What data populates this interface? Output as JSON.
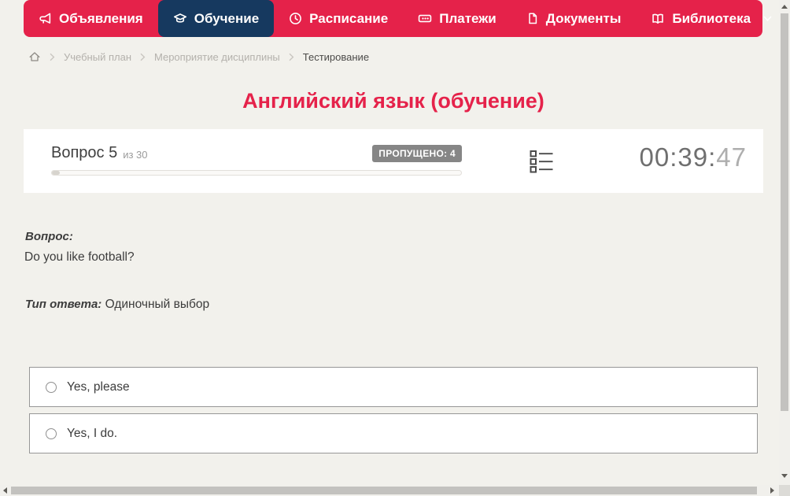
{
  "colors": {
    "navbar_bg": "#e5224a",
    "navbar_active_bg": "#16395f",
    "title_color": "#e5224a",
    "badge_bg": "#868686",
    "page_bg": "#f2f1ec"
  },
  "navbar": {
    "items": [
      {
        "label": "Объявления",
        "icon": "megaphone-icon",
        "active": false
      },
      {
        "label": "Обучение",
        "icon": "graduation-cap-icon",
        "active": true
      },
      {
        "label": "Расписание",
        "icon": "clock-icon",
        "active": false
      },
      {
        "label": "Платежи",
        "icon": "banknote-icon",
        "active": false
      },
      {
        "label": "Документы",
        "icon": "document-icon",
        "active": false
      },
      {
        "label": "Библиотека",
        "icon": "open-book-icon",
        "active": false,
        "has_dropdown": true
      }
    ]
  },
  "breadcrumb": {
    "items": [
      "Учебный план",
      "Мероприятие дисциплины",
      "Тестирование"
    ]
  },
  "page_title": "Английский язык (обучение)",
  "quiz_header": {
    "question_label": "Вопрос 5",
    "question_total": "из 30",
    "skipped_badge": "ПРОПУЩЕНО: 4",
    "progress_percent": 2,
    "timer": {
      "main": "00:39:",
      "seconds": "47"
    }
  },
  "question": {
    "prompt_label": "Вопрос:",
    "prompt_text": "Do you like football?",
    "answer_type_label": "Тип ответа:",
    "answer_type_value": "Одиночный выбор"
  },
  "options": [
    {
      "label": "Yes, please",
      "selected": false
    },
    {
      "label": "Yes, I do.",
      "selected": false
    }
  ]
}
